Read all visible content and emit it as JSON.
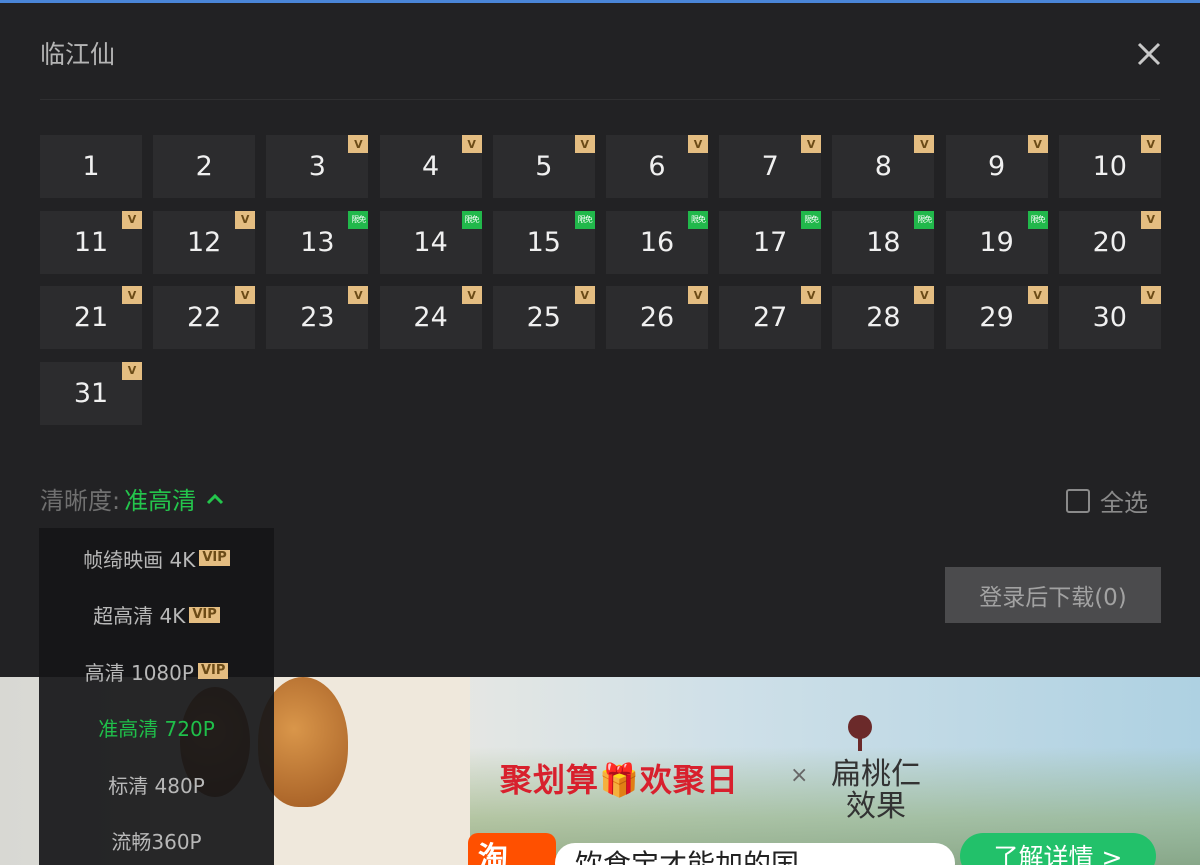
{
  "dialog": {
    "title": "临江仙",
    "episodes": [
      {
        "num": "1",
        "badge": ""
      },
      {
        "num": "2",
        "badge": ""
      },
      {
        "num": "3",
        "badge": "V"
      },
      {
        "num": "4",
        "badge": "V"
      },
      {
        "num": "5",
        "badge": "V"
      },
      {
        "num": "6",
        "badge": "V"
      },
      {
        "num": "7",
        "badge": "V"
      },
      {
        "num": "8",
        "badge": "V"
      },
      {
        "num": "9",
        "badge": "V"
      },
      {
        "num": "10",
        "badge": "V"
      },
      {
        "num": "11",
        "badge": "V"
      },
      {
        "num": "12",
        "badge": "V"
      },
      {
        "num": "13",
        "badge": "限免"
      },
      {
        "num": "14",
        "badge": "限免"
      },
      {
        "num": "15",
        "badge": "限免"
      },
      {
        "num": "16",
        "badge": "限免"
      },
      {
        "num": "17",
        "badge": "限免"
      },
      {
        "num": "18",
        "badge": "限免"
      },
      {
        "num": "19",
        "badge": "限免"
      },
      {
        "num": "20",
        "badge": "V"
      },
      {
        "num": "21",
        "badge": "V"
      },
      {
        "num": "22",
        "badge": "V"
      },
      {
        "num": "23",
        "badge": "V"
      },
      {
        "num": "24",
        "badge": "V"
      },
      {
        "num": "25",
        "badge": "V"
      },
      {
        "num": "26",
        "badge": "V"
      },
      {
        "num": "27",
        "badge": "V"
      },
      {
        "num": "28",
        "badge": "V"
      },
      {
        "num": "29",
        "badge": "V"
      },
      {
        "num": "30",
        "badge": "V"
      },
      {
        "num": "31",
        "badge": "V"
      }
    ],
    "clarity_label": "清晰度:",
    "clarity_value": "准高清",
    "select_all": "全选",
    "download_button": "登录后下载(0)"
  },
  "clarity_options": [
    {
      "label": "帧绮映画 4K",
      "vip": "VIP",
      "active": false
    },
    {
      "label": "超高清 4K",
      "vip": "VIP",
      "active": false
    },
    {
      "label": "高清 1080P",
      "vip": "VIP",
      "active": false
    },
    {
      "label": "准高清 720P",
      "vip": "",
      "active": true
    },
    {
      "label": "标清 480P",
      "vip": "",
      "active": false
    },
    {
      "label": "流畅360P",
      "vip": "",
      "active": false
    }
  ],
  "ad": {
    "slogan": "聚划算🎁欢聚日",
    "times": "×",
    "brand": "扁桃仁效果",
    "taobao": "淘",
    "search_text": "饮食宝才能加的国...",
    "more": "了解详情 >"
  },
  "colors": {
    "accent_green": "#24c54c",
    "vip_gold": "#e4bd81",
    "free_green": "#21b84b"
  }
}
